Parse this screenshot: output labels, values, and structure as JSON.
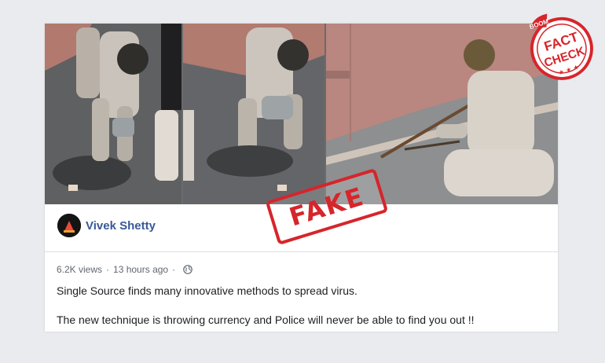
{
  "post": {
    "author": "Vivek Shetty",
    "views": "6.2K views",
    "separator": "·",
    "time": "13 hours ago",
    "separator2": "·",
    "text_line1": "Single Source finds many innovative methods to spread virus.",
    "text_line2": "The new technique is throwing currency and Police will never be able to find you out !!"
  },
  "stamp": {
    "label": "FAKE"
  },
  "badge": {
    "brand": "BOOM",
    "line1": "FACT",
    "line2": "CHECK"
  },
  "colors": {
    "author_link": "#385898",
    "stamp_red": "#d6252b",
    "background": "#e9ebee"
  },
  "icons": {
    "audience": "globe-icon"
  }
}
